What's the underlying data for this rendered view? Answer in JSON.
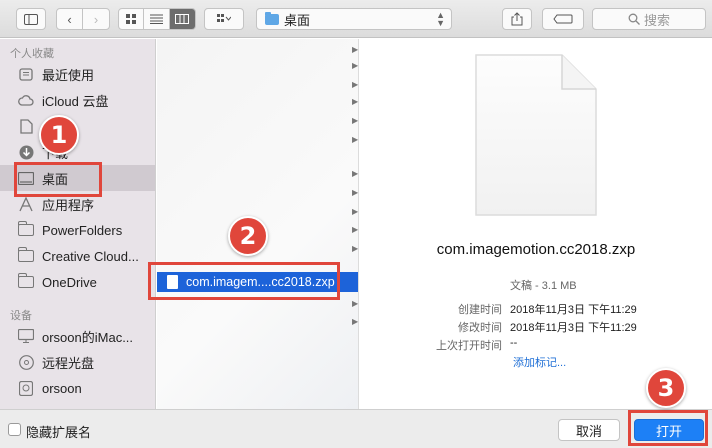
{
  "toolbar": {
    "path": "桌面",
    "search_placeholder": "搜索"
  },
  "sidebar": {
    "favorites_title": "个人收藏",
    "favorites": [
      {
        "label": "最近使用",
        "icon": "recents-icon"
      },
      {
        "label": "iCloud 云盘",
        "icon": "cloud-icon"
      },
      {
        "label": "",
        "icon": "documents-icon"
      },
      {
        "label": "下载",
        "icon": "downloads-icon"
      },
      {
        "label": "桌面",
        "icon": "desktop-icon",
        "selected": true
      },
      {
        "label": "应用程序",
        "icon": "applications-icon"
      },
      {
        "label": "PowerFolders",
        "icon": "folder-icon"
      },
      {
        "label": "Creative Cloud...",
        "icon": "folder-icon"
      },
      {
        "label": "OneDrive",
        "icon": "folder-icon"
      }
    ],
    "devices_title": "设备",
    "devices": [
      {
        "label": "orsoon的iMac...",
        "icon": "imac-icon"
      },
      {
        "label": "远程光盘",
        "icon": "disc-icon"
      },
      {
        "label": "orsoon",
        "icon": "harddisk-icon"
      }
    ]
  },
  "column": {
    "selected_file": "com.imagem....cc2018.zxp"
  },
  "preview": {
    "filename": "com.imagemotion.cc2018.zxp",
    "kind": "文稿 - 3.1 MB",
    "meta": [
      {
        "label": "创建时间",
        "value": "2018年11月3日 下午11:29"
      },
      {
        "label": "修改时间",
        "value": "2018年11月3日 下午11:29"
      },
      {
        "label": "上次打开时间",
        "value": "--"
      }
    ],
    "add_tags": "添加标记..."
  },
  "bottombar": {
    "hide_ext_label": "隐藏扩展名",
    "cancel_label": "取消",
    "open_label": "打开"
  },
  "annotations": [
    "1",
    "2",
    "3"
  ],
  "colors": {
    "highlight": "#e0463b",
    "accent": "#1d80f6",
    "selection": "#1d63d9"
  }
}
